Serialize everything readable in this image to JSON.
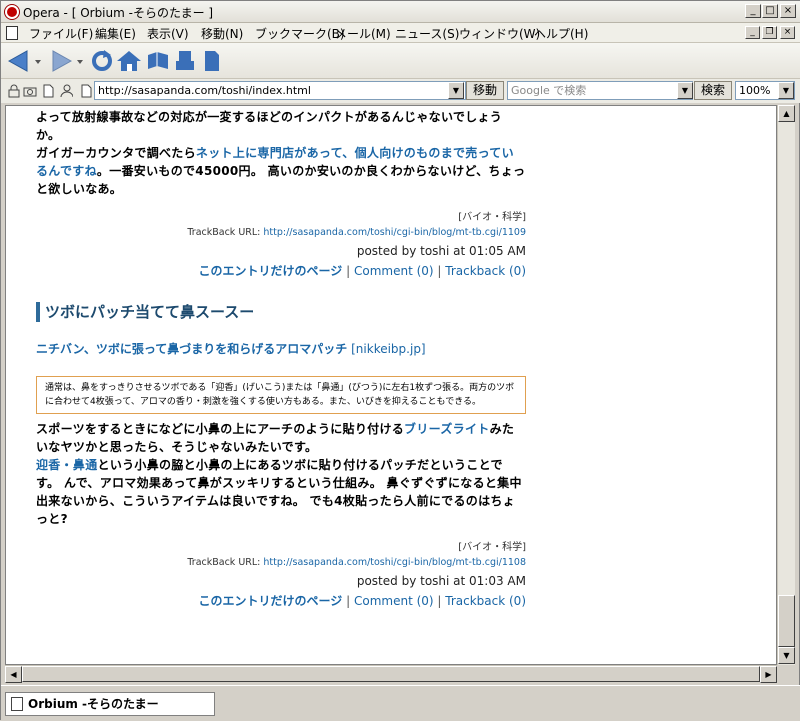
{
  "window": {
    "title": "Opera - [ Orbium -そらのたまー ]",
    "minimize": "_",
    "maximize": "□",
    "close": "×"
  },
  "menu": {
    "items": [
      "ファイル(F)",
      "編集(E)",
      "表示(V)",
      "移動(N)",
      "ブックマーク(B)",
      "メール(M)",
      "ニュース(S)",
      "ウィンドウ(W)",
      "ヘルプ(H)"
    ]
  },
  "address": {
    "url": "http://sasapanda.com/toshi/index.html",
    "go_label": "移動",
    "search_placeholder": "Google で検索",
    "search_label": "検索",
    "zoom": "100%"
  },
  "article1": {
    "line1": "よって放射線事故などの対応が一変するほどのインパクトがあるんじゃないでしょうか。",
    "line2_text": "ガイガーカウンタで調べたら",
    "line2_link": "ネット上に専門店があって、個人向けのものまで売っているんですね",
    "line3": "。一番安いもので45000円。 高いのか安いのか良くわからないけど、ちょっと欲しいなあ。",
    "category": "[バイオ・科学]",
    "trackback_prefix": "TrackBack URL: ",
    "trackback_url": "http://sasapanda.com/toshi/cgi-bin/blog/mt-tb.cgi/1109",
    "posted": "posted by toshi at 01:05 AM",
    "entry_link": "このエントリだけのページ",
    "sep": " | ",
    "comment": "Comment (0)",
    "trackback": "Trackback (0)"
  },
  "article2": {
    "title": "ツボにパッチ当てて鼻スースー",
    "source_link": "ニチバン、ツボに張って鼻づまりを和らげるアロマパッチ",
    "source_site": "[nikkeibp.jp]",
    "quote": "通常は、鼻をすっきりさせるツボである「迎香」(げいこう)または「鼻通」(びつう)に左右1枚ずつ張る。両方のツボに合わせて4枚張って、アロマの香り・刺激を強くする使い方もある。また、いびきを抑えることもできる。",
    "body1": "スポーツをするときになどに小鼻の上にアーチのように貼り付ける",
    "body1_link": "ブリーズライト",
    "body2": "みたいなヤツかと思ったら、そうじゃないみたいです。",
    "body3_link": "迎香・鼻通",
    "body3": "という小鼻の脇と小鼻の上にあるツボに貼り付けるパッチだということです。 んで、アロマ効果あって鼻がスッキリするという仕組み。 鼻ぐずぐずになると集中出来ないから、こういうアイテムは良いですね。 でも4枚貼ったら人前にでるのはちょっと?",
    "category": "[バイオ・科学]",
    "trackback_prefix": "TrackBack URL: ",
    "trackback_url": "http://sasapanda.com/toshi/cgi-bin/blog/mt-tb.cgi/1108",
    "posted": "posted by toshi at 01:03 AM",
    "entry_link": "このエントリだけのページ",
    "sep": " | ",
    "comment": "Comment (0)",
    "trackback": "Trackback (0)"
  },
  "tab": {
    "label": "Orbium -そらのたまー"
  },
  "colors": {
    "link": "#1a66a6",
    "heading": "#1d4a6e",
    "quote_border": "#e0a050"
  },
  "icons": [
    "back-icon",
    "forward-icon",
    "reload-icon",
    "home-icon",
    "hotlist-icon",
    "print-icon",
    "document-icon"
  ]
}
